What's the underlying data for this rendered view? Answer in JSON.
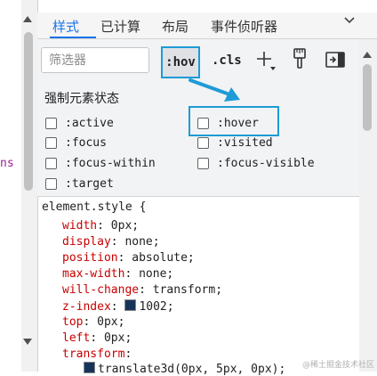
{
  "left_panel": {
    "fragment_text": "ns"
  },
  "tabs": [
    {
      "label": "样式",
      "active": true
    },
    {
      "label": "已计算",
      "active": false
    },
    {
      "label": "布局",
      "active": false
    },
    {
      "label": "事件侦听器",
      "active": false
    }
  ],
  "tab_more_icon": "chevron-down-icon",
  "toolbar": {
    "filter_placeholder": "筛选器",
    "hov_label": ":hov",
    "cls_label": ".cls",
    "icons": [
      "new-style-rule-icon",
      "computed-styles-brush-icon",
      "toggle-sidebar-icon"
    ]
  },
  "force_state": {
    "title": "强制元素状态",
    "states": [
      {
        "label": ":active",
        "checked": false
      },
      {
        "label": ":hover",
        "checked": false,
        "highlighted": true
      },
      {
        "label": ":focus",
        "checked": false
      },
      {
        "label": ":visited",
        "checked": false
      },
      {
        "label": ":focus-within",
        "checked": false
      },
      {
        "label": ":focus-visible",
        "checked": false
      },
      {
        "label": ":target",
        "checked": false
      }
    ]
  },
  "styles": {
    "selector": "element.style {",
    "declarations": [
      {
        "prop": "width",
        "value": "0px;"
      },
      {
        "prop": "display",
        "value": "none;"
      },
      {
        "prop": "position",
        "value": "absolute;"
      },
      {
        "prop": "max-width",
        "value": "none;"
      },
      {
        "prop": "will-change",
        "value": "transform;"
      },
      {
        "prop": "z-index",
        "value": "1002;"
      },
      {
        "prop": "top",
        "value": "0px;"
      },
      {
        "prop": "left",
        "value": "0px;"
      },
      {
        "prop": "transform",
        "value": ""
      }
    ],
    "transform_value": "translate3d(0px, 5px, 0px);"
  },
  "colors": {
    "accent": "#1a73e8",
    "highlight_box": "#1e9bd7",
    "property": "#c80000",
    "swatch": "#16345a"
  },
  "watermark": "@稀土掘金技术社区"
}
